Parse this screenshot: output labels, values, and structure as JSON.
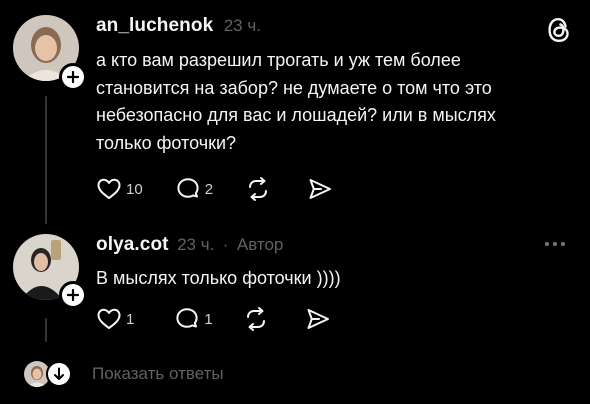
{
  "app": {
    "logo_icon": "threads-logo-icon"
  },
  "comments": [
    {
      "username": "an_luchenok",
      "time": "23 ч.",
      "author_badge": "",
      "text_lines": [
        "а кто вам разрешил трогать и уж тем более",
        "становится на забор? не думаете о том что это",
        "небезопасно для вас и лошадей? или в мыслях",
        "только фоточки?"
      ],
      "likes": "10",
      "replies": "2"
    },
    {
      "username": "olya.cot",
      "time": "23 ч.",
      "separator": "·",
      "author_badge": "Автор",
      "text_lines": [
        "В мыслях только фоточки ))))"
      ],
      "likes": "1",
      "replies": "1"
    }
  ],
  "show_replies_label": "Показать ответы",
  "colors": {
    "background": "#000000",
    "text": "#f3f5f7",
    "muted": "#616161",
    "thread_line": "#333638"
  }
}
